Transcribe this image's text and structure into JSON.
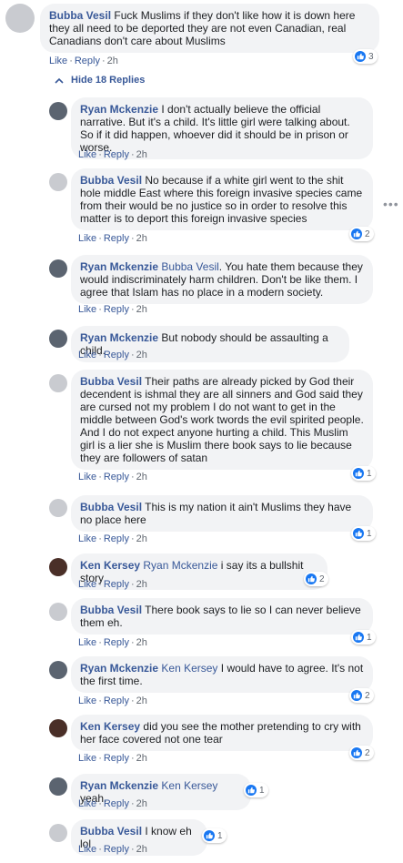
{
  "actions": {
    "like": "Like",
    "reply": "Reply",
    "sep": "·"
  },
  "hide_replies": "Hide 18 Replies",
  "more": "•••",
  "comments": [
    {
      "name": "Bubba Vesil",
      "text": "Fuck Muslims if they don't like how it is down here they all need to be deported they are not even Canadian, real Canadians don't care about Muslims",
      "time": "2h",
      "reactions": "3"
    },
    {
      "name": "Ryan Mckenzie",
      "text": "I don't actually believe the official narrative. But it's a child. It's little girl were talking about. So if it did happen, whoever did it should be in prison or worse.",
      "time": "2h",
      "reactions": ""
    },
    {
      "name": "Bubba Vesil",
      "text": "No because if a white girl went to the shit hole middle East where this foreign invasive species came from their would be no justice so in order to resolve this matter is to deport this foreign invasive species",
      "time": "2h",
      "reactions": "2"
    },
    {
      "name": "Ryan Mckenzie",
      "tag": "Bubba Vesil",
      "text": ". You hate them because they would indiscriminately harm children. Don't be like them. I agree that Islam has no place in a modern society.",
      "time": "2h",
      "reactions": ""
    },
    {
      "name": "Ryan Mckenzie",
      "text": "But nobody should be assaulting a child.",
      "time": "2h",
      "reactions": ""
    },
    {
      "name": "Bubba Vesil",
      "text": "Their paths are already picked by God their decendent is ishmal they are all sinners and God said they are cursed not my problem I do not want to get in the middle between God's work twords the evil spirited people. And I do not expect anyone hurting a child. This Muslim girl is a lier she is Muslim there book says to lie because they are followers of satan",
      "time": "2h",
      "reactions": "1"
    },
    {
      "name": "Bubba Vesil",
      "text": "This is my nation it ain't Muslims they have no place here",
      "time": "2h",
      "reactions": "1"
    },
    {
      "name": "Ken Kersey",
      "tag": "Ryan Mckenzie",
      "text": "i say its a bullshit story",
      "time": "2h",
      "reactions": "2"
    },
    {
      "name": "Bubba Vesil",
      "text": "There book says to lie so I can never believe them eh.",
      "time": "2h",
      "reactions": "1"
    },
    {
      "name": "Ryan Mckenzie",
      "tag": "Ken Kersey",
      "text": "I would have to agree. It's not the first time.",
      "time": "2h",
      "reactions": "2"
    },
    {
      "name": "Ken Kersey",
      "text": "did you see the mother pretending to cry with her face covered not one tear",
      "time": "2h",
      "reactions": "2"
    },
    {
      "name": "Ryan Mckenzie",
      "tag": "Ken Kersey",
      "text": "yeah.",
      "time": "2h",
      "reactions": "1"
    },
    {
      "name": "Bubba Vesil",
      "text": "I know eh lol",
      "time": "2h",
      "reactions": "1"
    }
  ]
}
